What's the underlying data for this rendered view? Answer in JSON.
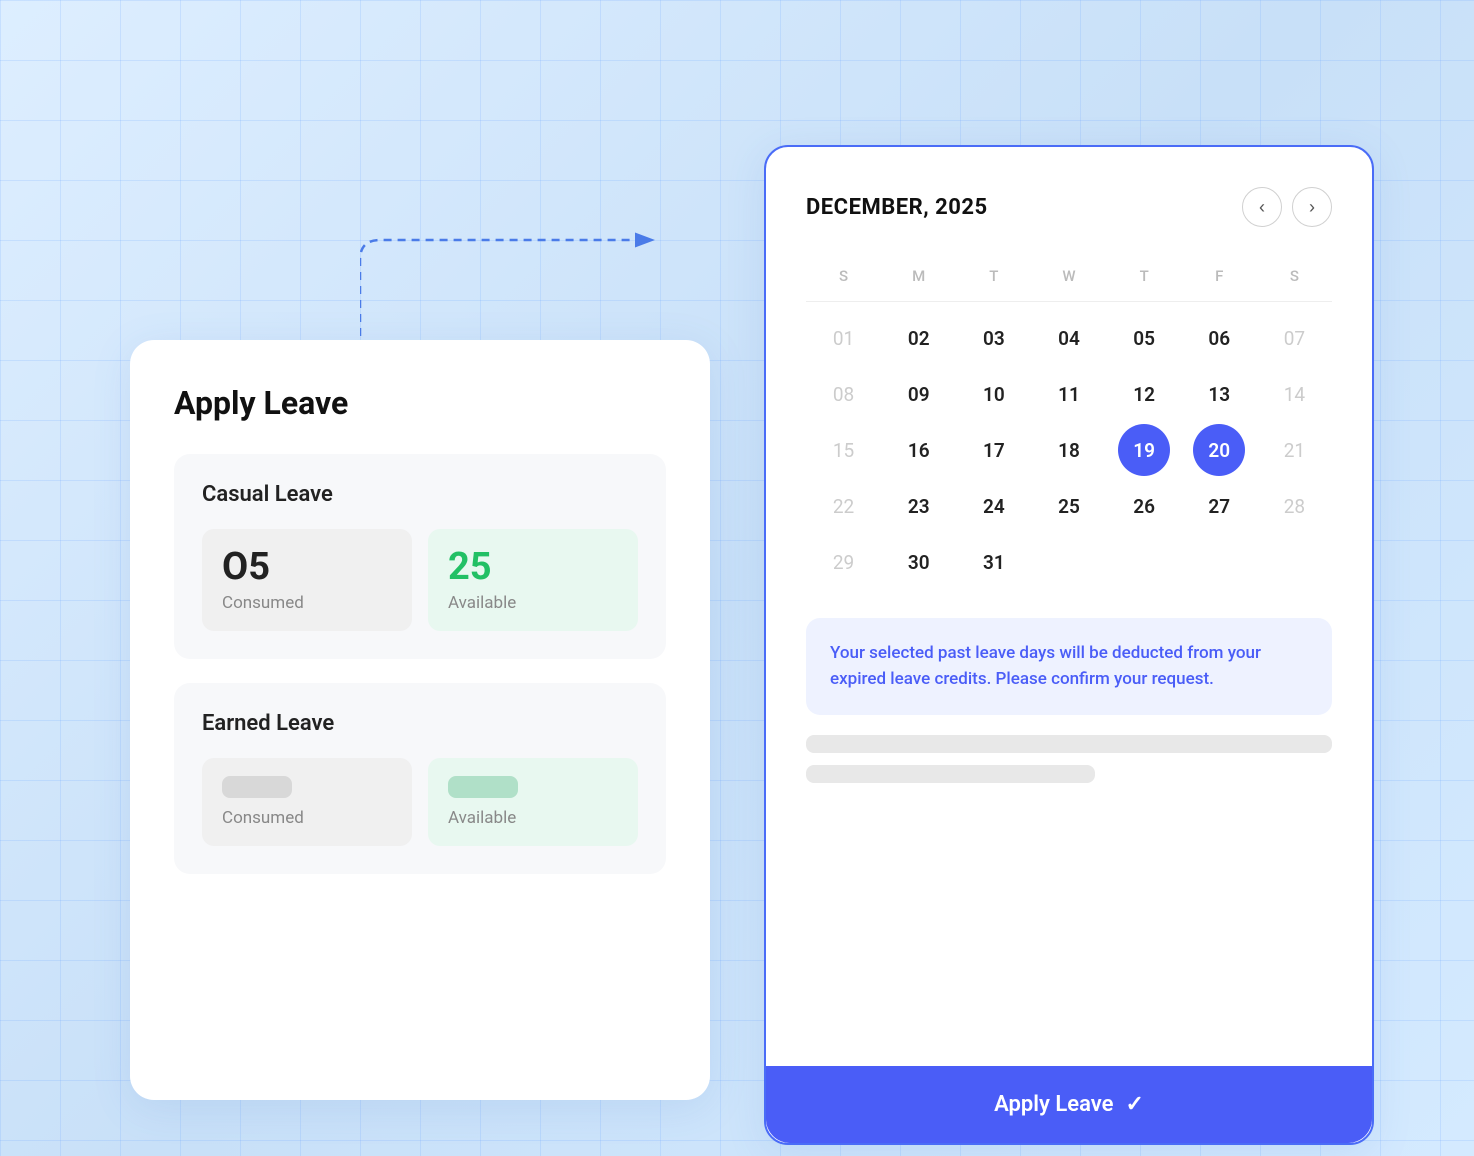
{
  "background": {
    "color": "#c8dff7"
  },
  "applyLeavePanel": {
    "title": "Apply Leave",
    "casualLeave": {
      "title": "Casual Leave",
      "consumed": {
        "value": "O5",
        "label": "Consumed"
      },
      "available": {
        "value": "25",
        "label": "Available"
      }
    },
    "earnedLeave": {
      "title": "Earned Leave",
      "consumed": {
        "label": "Consumed"
      },
      "available": {
        "label": "Available"
      }
    }
  },
  "calendarPanel": {
    "monthTitle": "DECEMBER, 2025",
    "navPrev": "‹",
    "navNext": "›",
    "dayHeaders": [
      "S",
      "M",
      "T",
      "W",
      "T",
      "F",
      "S"
    ],
    "weeks": [
      [
        {
          "label": "01",
          "muted": true
        },
        {
          "label": "02"
        },
        {
          "label": "03"
        },
        {
          "label": "04"
        },
        {
          "label": "05"
        },
        {
          "label": "06"
        },
        {
          "label": "07",
          "muted": true
        }
      ],
      [
        {
          "label": "08",
          "muted": true
        },
        {
          "label": "09"
        },
        {
          "label": "10"
        },
        {
          "label": "11"
        },
        {
          "label": "12"
        },
        {
          "label": "13"
        },
        {
          "label": "14",
          "muted": true
        }
      ],
      [
        {
          "label": "15",
          "muted": true
        },
        {
          "label": "16"
        },
        {
          "label": "17"
        },
        {
          "label": "18"
        },
        {
          "label": "19",
          "selected": true
        },
        {
          "label": "20",
          "selected": true
        },
        {
          "label": "21",
          "muted": true
        }
      ],
      [
        {
          "label": "22",
          "muted": true
        },
        {
          "label": "23"
        },
        {
          "label": "24"
        },
        {
          "label": "25"
        },
        {
          "label": "26"
        },
        {
          "label": "27"
        },
        {
          "label": "28",
          "muted": true
        }
      ],
      [
        {
          "label": "29",
          "muted": true
        },
        {
          "label": "30"
        },
        {
          "label": "31"
        },
        {
          "label": "",
          "muted": true
        },
        {
          "label": "",
          "muted": true
        },
        {
          "label": "",
          "muted": true
        },
        {
          "label": "",
          "muted": true
        }
      ]
    ],
    "infoMessage": "Your selected past leave days will be deducted from your expired leave credits. Please confirm your request.",
    "applyButton": "Apply Leave"
  }
}
